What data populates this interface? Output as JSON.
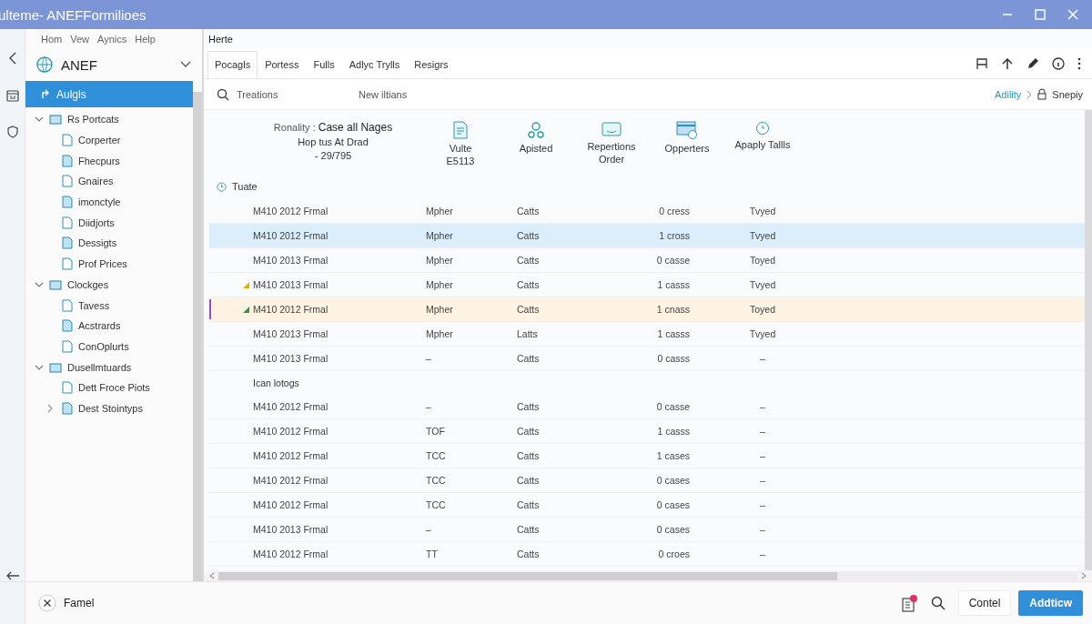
{
  "window": {
    "title": "ulteme- ANEFFormilioes"
  },
  "menu": [
    "Hom",
    "Vew",
    "Aynics",
    "Help"
  ],
  "workspace": {
    "label": "ANEF"
  },
  "sidebar": {
    "items": [
      {
        "label": "Aulgls",
        "selected": true
      },
      {
        "label": "Rs Portcats",
        "selected": false,
        "expanded": true,
        "children": [
          {
            "label": "Corperter",
            "selected": false
          },
          {
            "label": "Fhecpurs",
            "selected": false
          },
          {
            "label": "Gnaires",
            "selected": false
          },
          {
            "label": "imonctyle",
            "selected": false
          },
          {
            "label": "Diidjorts",
            "selected": false
          },
          {
            "label": "Dessigts",
            "selected": false
          },
          {
            "label": "Prof Prices",
            "selected": false
          }
        ]
      },
      {
        "label": "Clockges",
        "selected": false,
        "expanded": true,
        "children": [
          {
            "label": "Tavess",
            "selected": false
          },
          {
            "label": "Acstrards",
            "selected": false
          },
          {
            "label": "ConOplurts",
            "selected": false
          }
        ]
      },
      {
        "label": "Dusellmtuards",
        "selected": false,
        "expanded": true,
        "children": [
          {
            "label": "Dett Froce Piots",
            "selected": false
          },
          {
            "label": "Dest Stointyps",
            "selected": false,
            "expanded": false
          }
        ]
      }
    ]
  },
  "header": "Herte",
  "tabs": [
    {
      "label": "Pocagls",
      "selected": true
    },
    {
      "label": "Portess",
      "selected": false
    },
    {
      "label": "Fulls",
      "selected": false
    },
    {
      "label": "Adlyc Trylls",
      "selected": false
    },
    {
      "label": "Resigrs",
      "selected": false
    }
  ],
  "search": {
    "placeholder": "Treations"
  },
  "new_items": "New iltians",
  "breadcrumb": {
    "link": "Adility",
    "current": "Snepiy"
  },
  "ribbon": {
    "label": "Ronality :",
    "title": "Case all Nages",
    "subtitle": "Hop tus At Drad",
    "code": "- 29/795",
    "actions": [
      {
        "lines": [
          "Vulte",
          "E5113"
        ]
      },
      {
        "lines": [
          "Apisted"
        ]
      },
      {
        "lines": [
          "Repertions",
          "Order"
        ]
      },
      {
        "lines": [
          "Opperters"
        ]
      },
      {
        "lines": [
          "Apaply Tallls"
        ]
      }
    ]
  },
  "section": "Tuate",
  "table": {
    "rows": [
      {
        "kind": "row",
        "cells": [
          "M410 2012 Frmal",
          "Mpher",
          "Catts",
          "0 cress",
          "Tvyed"
        ],
        "selected": false,
        "flagged": false
      },
      {
        "kind": "row",
        "cells": [
          "M410 2012 Frmal",
          "Mpher",
          "Catts",
          "1 cross",
          "Tvyed"
        ],
        "selected": true,
        "flagged": false
      },
      {
        "kind": "row",
        "cells": [
          "M410 2013 Frmal",
          "Mpher",
          "Catts",
          "0 casse",
          "Toyed"
        ],
        "selected": false,
        "flagged": false
      },
      {
        "kind": "row",
        "cells": [
          "M410 2013 Frmal",
          "Mpher",
          "Catts",
          "1 casss",
          "Tvyed"
        ],
        "selected": false,
        "flagged": false,
        "color": "#e6b000"
      },
      {
        "kind": "row",
        "cells": [
          "M410 2012 Frmal",
          "Mpher",
          "Catts",
          "1 cnass",
          "Toyed"
        ],
        "selected": false,
        "flagged": true,
        "color": "#2e9e3e"
      },
      {
        "kind": "row",
        "cells": [
          "M410 2013 Frmal",
          "Mpher",
          "Latts",
          "1 casss",
          "Tvyed"
        ],
        "selected": false,
        "flagged": false
      },
      {
        "kind": "row",
        "cells": [
          "M410 2013 Frmal",
          "–",
          "Catts",
          "0 casss",
          "–"
        ],
        "selected": false,
        "flagged": false
      },
      {
        "kind": "group",
        "label": "Ican lotogs"
      },
      {
        "kind": "row",
        "cells": [
          "M410 2012 Frmal",
          "–",
          "Catts",
          "0 casse",
          "–"
        ],
        "selected": false,
        "flagged": false
      },
      {
        "kind": "row",
        "cells": [
          "M410 2012 Frmal",
          "TOF",
          "Catts",
          "1 casss",
          "–"
        ],
        "selected": false,
        "flagged": false
      },
      {
        "kind": "row",
        "cells": [
          "M410 2012 Frmal",
          "TCC",
          "Catts",
          "1 cases",
          "–"
        ],
        "selected": false,
        "flagged": false
      },
      {
        "kind": "row",
        "cells": [
          "M410 2012 Frmal",
          "TCC",
          "Catts",
          "0 cases",
          "–"
        ],
        "selected": false,
        "flagged": false
      },
      {
        "kind": "row",
        "cells": [
          "M410 2012 Frmal",
          "TCC",
          "Catts",
          "0 cases",
          "–"
        ],
        "selected": false,
        "flagged": false
      },
      {
        "kind": "row",
        "cells": [
          "M410 2013 Frmal",
          "–",
          "Catts",
          "0 cases",
          "–"
        ],
        "selected": false,
        "flagged": false
      },
      {
        "kind": "row",
        "cells": [
          "M410 2012 Frmal",
          "TT",
          "Catts",
          "0 croes",
          "–"
        ],
        "selected": false,
        "flagged": false
      }
    ]
  },
  "footer": {
    "filter": "Famel",
    "cancel": "Contel",
    "primary": "Addticw"
  }
}
